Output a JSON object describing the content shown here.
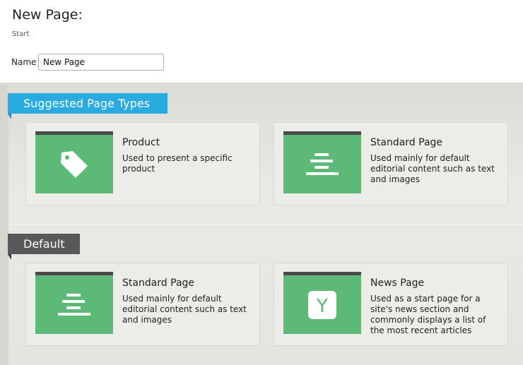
{
  "header": {
    "title": "New Page:",
    "breadcrumb": "Start",
    "name_label": "Name",
    "name_value": "New Page"
  },
  "sections": {
    "suggested": {
      "label": "Suggested Page Types",
      "color": "#29abe2",
      "cards": [
        {
          "title": "Product",
          "description": "Used to present a specific product",
          "icon": "tag-icon"
        },
        {
          "title": "Standard Page",
          "description": "Used mainly for default editorial content such as text and images",
          "icon": "text-lines-icon"
        }
      ]
    },
    "default": {
      "label": "Default",
      "color": "#58595b",
      "cards": [
        {
          "title": "Standard Page",
          "description": "Used mainly for default editorial content such as text and images",
          "icon": "text-lines-icon"
        },
        {
          "title": "News Page",
          "description": "Used as a start page for a site's news section and commonly displays a list of the most recent articles",
          "icon": "y-icon",
          "icon_text": "Y"
        }
      ]
    }
  },
  "colors": {
    "thumbnail_green": "#5dba76",
    "thumbnail_bar": "#4a4a4c"
  }
}
